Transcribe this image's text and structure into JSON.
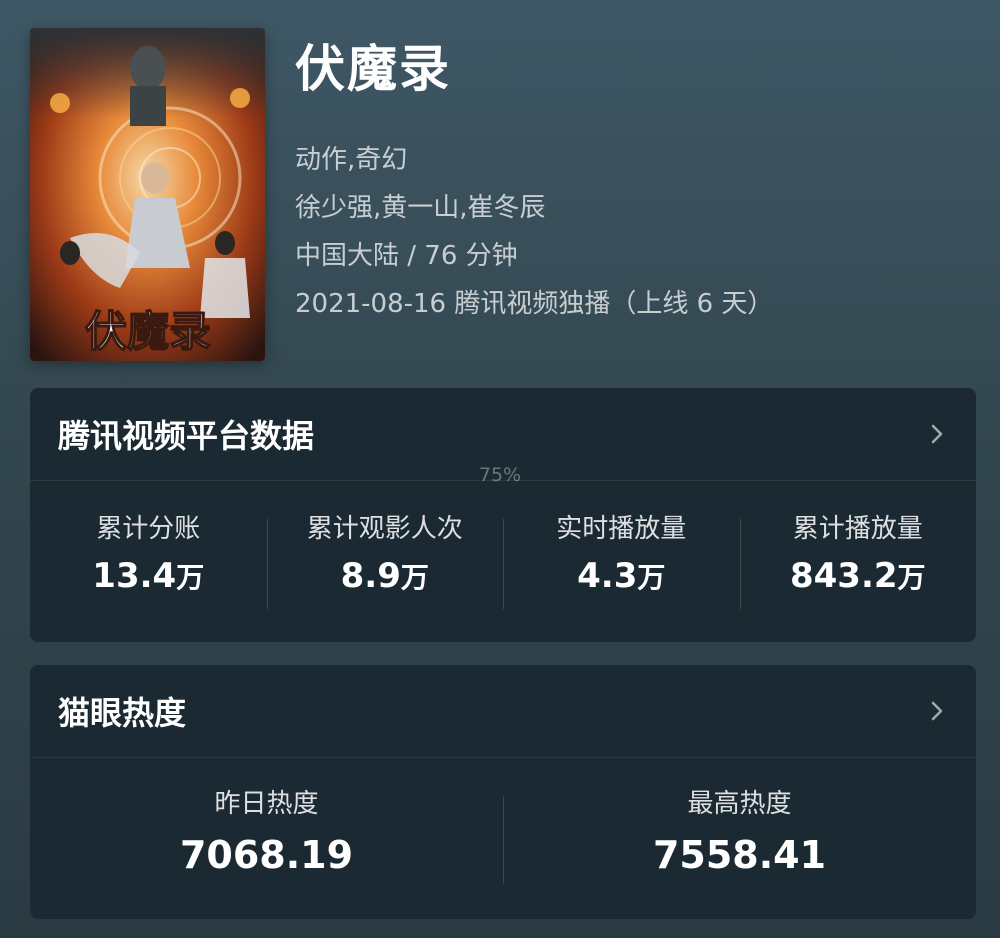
{
  "movie": {
    "title": "伏魔录",
    "genre": "动作,奇幻",
    "cast": "徐少强,黄一山,崔冬辰",
    "region_duration": "中国大陆 / 76 分钟",
    "release_info": "2021-08-16 腾讯视频独播（上线 6 天）",
    "poster_text": "伏魔录"
  },
  "zoom": "75%",
  "platform_card": {
    "title": "腾讯视频平台数据",
    "stats": [
      {
        "label": "累计分账",
        "value": "13.4",
        "unit": "万"
      },
      {
        "label": "累计观影人次",
        "value": "8.9",
        "unit": "万"
      },
      {
        "label": "实时播放量",
        "value": "4.3",
        "unit": "万"
      },
      {
        "label": "累计播放量",
        "value": "843.2",
        "unit": "万"
      }
    ]
  },
  "heat_card": {
    "title": "猫眼热度",
    "stats": [
      {
        "label": "昨日热度",
        "value": "7068.19"
      },
      {
        "label": "最高热度",
        "value": "7558.41"
      }
    ]
  },
  "colors": {
    "background": "#3a4f5a",
    "card": "#1b2a32",
    "text": "#ffffff"
  },
  "icons": {
    "chevron": "chevron-right-icon"
  }
}
